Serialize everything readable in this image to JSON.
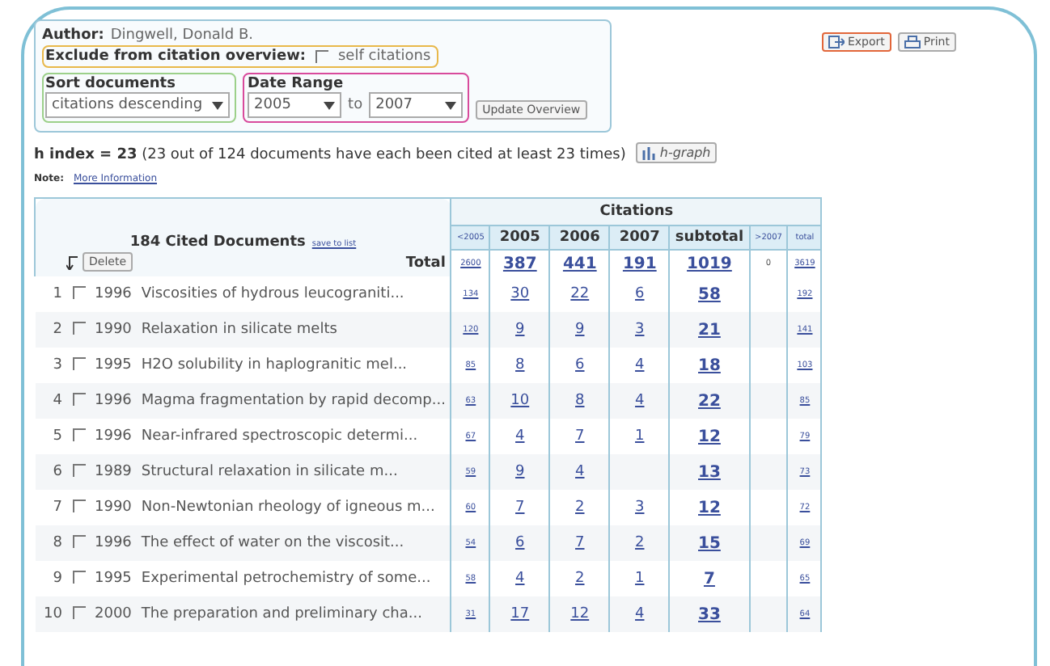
{
  "author": {
    "label": "Author:",
    "value": "Dingwell, Donald B."
  },
  "exclude": {
    "label": "Exclude from citation overview:",
    "option": "self citations",
    "checked": false
  },
  "sort": {
    "label": "Sort documents",
    "value": "citations descending"
  },
  "date_range": {
    "label": "Date Range",
    "from": "2005",
    "separator": "to",
    "to": "2007"
  },
  "update_button": "Update Overview",
  "export_button": "Export",
  "print_button": "Print",
  "h_index": {
    "text": "**h index = 23** (23 out of 124 documents have each been cited at least 23 times)",
    "graph_button": "h-graph"
  },
  "note": {
    "label": "Note:",
    "link": "More Information"
  },
  "documents": {
    "title": "184 Cited Documents",
    "save_link": "save to list",
    "delete_button": "Delete",
    "total_label": "Total"
  },
  "citations": {
    "title": "Citations",
    "columns": [
      {
        "label": "<2005",
        "kind": "minor"
      },
      {
        "label": "2005",
        "kind": "year"
      },
      {
        "label": "2006",
        "kind": "year"
      },
      {
        "label": "2007",
        "kind": "year"
      },
      {
        "label": "subtotal",
        "kind": "subtotal"
      },
      {
        "label": ">2007",
        "kind": "minor"
      },
      {
        "label": "total",
        "kind": "minor"
      }
    ],
    "totals": [
      "2600",
      "387",
      "441",
      "191",
      "1019",
      "0",
      "3619"
    ]
  },
  "rows": [
    {
      "num": "1",
      "checked": false,
      "year": "1996",
      "title": "Viscosities of hydrous leucograniti...",
      "counts": {
        "before": "134",
        "y2005": "30",
        "y2006": "22",
        "y2007": "6",
        "subtotal": "58",
        "total": "192"
      }
    },
    {
      "num": "2",
      "checked": false,
      "year": "1990",
      "title": "Relaxation in silicate melts",
      "counts": {
        "before": "120",
        "y2005": "9",
        "y2006": "9",
        "y2007": "3",
        "subtotal": "21",
        "total": "141"
      }
    },
    {
      "num": "3",
      "checked": false,
      "year": "1995",
      "title": "H2O solubility in haplogranitic mel...",
      "counts": {
        "before": "85",
        "y2005": "8",
        "y2006": "6",
        "y2007": "4",
        "subtotal": "18",
        "total": "103"
      }
    },
    {
      "num": "4",
      "checked": false,
      "year": "1996",
      "title": "Magma fragmentation by rapid decomp...",
      "counts": {
        "before": "63",
        "y2005": "10",
        "y2006": "8",
        "y2007": "4",
        "subtotal": "22",
        "total": "85"
      }
    },
    {
      "num": "5",
      "checked": false,
      "year": "1996",
      "title": "Near-infrared spectroscopic determi...",
      "counts": {
        "before": "67",
        "y2005": "4",
        "y2006": "7",
        "y2007": "1",
        "subtotal": "12",
        "total": "79"
      }
    },
    {
      "num": "6",
      "checked": false,
      "year": "1989",
      "title": "Structural relaxation in silicate m...",
      "counts": {
        "before": "59",
        "y2005": "9",
        "y2006": "4",
        "subtotal": "13",
        "total": "73"
      }
    },
    {
      "num": "7",
      "checked": false,
      "year": "1990",
      "title": "Non-Newtonian rheology of igneous m...",
      "counts": {
        "before": "60",
        "y2005": "7",
        "y2006": "2",
        "y2007": "3",
        "subtotal": "12",
        "total": "72"
      }
    },
    {
      "num": "8",
      "checked": false,
      "year": "1996",
      "title": "The effect of water on the viscosit...",
      "counts": {
        "before": "54",
        "y2005": "6",
        "y2006": "7",
        "y2007": "2",
        "subtotal": "15",
        "total": "69"
      }
    },
    {
      "num": "9",
      "checked": false,
      "year": "1995",
      "title": "Experimental petrochemistry of some...",
      "counts": {
        "before": "58",
        "y2005": "4",
        "y2006": "2",
        "y2007": "1",
        "subtotal": "7",
        "total": "65"
      }
    },
    {
      "num": "10",
      "checked": false,
      "year": "2000",
      "title": "The preparation and preliminary cha...",
      "counts": {
        "before": "31",
        "y2005": "17",
        "y2006": "12",
        "y2007": "4",
        "subtotal": "33",
        "total": "64"
      }
    }
  ]
}
